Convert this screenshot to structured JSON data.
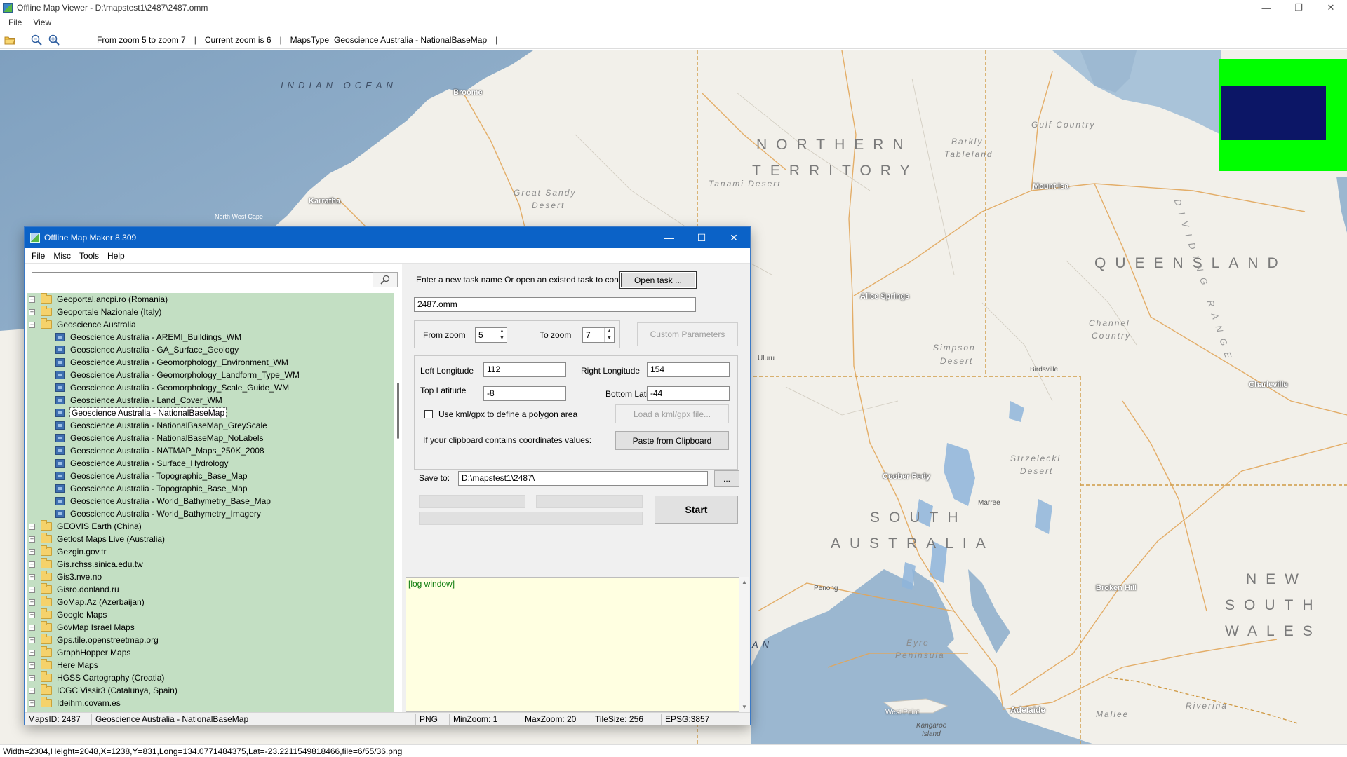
{
  "window": {
    "title": "Offline Map Viewer - D:\\mapstest1\\2487\\2487.omm",
    "controls": {
      "minimize": "—",
      "restore": "❐",
      "close": "✕"
    }
  },
  "menu": {
    "file": "File",
    "view": "View"
  },
  "toolbar": {
    "icons": [
      "folder-open-icon",
      "zoom-out-icon",
      "zoom-in-icon"
    ],
    "zoom_range": "From zoom 5 to zoom 7",
    "separator": "|",
    "current_zoom": "Current zoom is 6",
    "maps_type": "MapsType=Geoscience Australia - NationalBaseMap"
  },
  "map": {
    "region_labels": {
      "indian_ocean": "INDIAN OCEAN",
      "northern": "NORTHERN",
      "territory": "TERRITORY",
      "queensland": "QUEENSLAND",
      "south": "SOUTH",
      "australia": "AUSTRALIA",
      "new": "NEW",
      "south2": "SOUTH",
      "wales": "WALES",
      "dividing_range": "DIVIDING RANGE",
      "ocean_bottom": "AN"
    },
    "feature_labels": {
      "great_sandy": "Great Sandy",
      "desert": "Desert",
      "tanami": "Tanami Desert",
      "barkly": "Barkly",
      "tableland": "Tableland",
      "gulf_country": "Gulf Country",
      "channel": "Channel",
      "country": "Country",
      "simpson": "Simpson",
      "desert2": "Desert",
      "strzelecki": "Strzelecki",
      "desert3": "Desert",
      "eyre": "Eyre",
      "peninsula": "Peninsula",
      "mallee": "Mallee",
      "riverina": "Riverina",
      "kangaroo": "Kangaroo",
      "island": "Island",
      "north_west_cape": "North\nWest Cape"
    },
    "cities": {
      "broome": "Broome",
      "karratha": "Karratha",
      "mount_isa": "Mount Isa",
      "alice_springs": "Alice Springs",
      "charleville": "Charleville",
      "coober_pedy": "Coober Pedy",
      "broken_hill": "Broken Hill",
      "adelaide": "Adelaide"
    },
    "towns": {
      "birdsville": "Birdsville",
      "uluru": "Uluru",
      "marree": "Marree",
      "penong": "Penong",
      "west_point": "West Point"
    },
    "overview_colors": {
      "background": "#00ff00",
      "viewport": "#0c1666"
    }
  },
  "status_bar": "Width=2304,Height=2048,X=1238,Y=831,Long=134.0771484375,Lat=-23.2211549818466,file=6/55/36.png",
  "dialog": {
    "title": "Offline Map Maker 8.309",
    "controls": {
      "minimize": "—",
      "maximize": "☐",
      "close": "✕"
    },
    "menu": {
      "file": "File",
      "misc": "Misc",
      "tools": "Tools",
      "help": "Help"
    },
    "search": {
      "value": "",
      "button_icon": "magnifier-icon"
    },
    "tree": {
      "top_providers": [
        "Geoportal.ancpi.ro (Romania)",
        "Geoportale Nazionale (Italy)"
      ],
      "expanded_provider": "Geoscience Australia",
      "expanded_children": [
        "Geoscience Australia - AREMI_Buildings_WM",
        "Geoscience Australia - GA_Surface_Geology",
        "Geoscience Australia - Geomorphology_Environment_WM",
        "Geoscience Australia - Geomorphology_Landform_Type_WM",
        "Geoscience Australia - Geomorphology_Scale_Guide_WM",
        "Geoscience Australia - Land_Cover_WM",
        "Geoscience Australia - NationalBaseMap",
        "Geoscience Australia - NationalBaseMap_GreyScale",
        "Geoscience Australia - NationalBaseMap_NoLabels",
        "Geoscience Australia - NATMAP_Maps_250K_2008",
        "Geoscience Australia - Surface_Hydrology",
        "Geoscience Australia - Topographic_Base_Map",
        "Geoscience Australia - Topographic_Base_Map",
        "Geoscience Australia - World_Bathymetry_Base_Map",
        "Geoscience Australia - World_Bathymetry_Imagery"
      ],
      "selected_index": 6,
      "bottom_providers": [
        "GEOVIS Earth (China)",
        "Getlost Maps Live (Australia)",
        "Gezgin.gov.tr",
        "Gis.rchss.sinica.edu.tw",
        "Gis3.nve.no",
        "Gisro.donland.ru",
        "GoMap.Az (Azerbaijan)",
        "Google Maps",
        "GovMap Israel Maps",
        "Gps.tile.openstreetmap.org",
        "GraphHopper Maps",
        "Here Maps",
        "HGSS Cartography (Croatia)",
        "ICGC Vissir3 (Catalunya, Spain)",
        "Ideihm.covam.es"
      ],
      "expander_collapsed": "+",
      "expander_expanded": "−"
    },
    "task": {
      "prompt": "Enter a new task name Or open an existed task to continue:",
      "open_button": "Open task ...",
      "name_value": "2487.omm"
    },
    "zoom": {
      "from_label": "From zoom",
      "from_value": "5",
      "to_label": "To zoom",
      "to_value": "7",
      "custom_button": "Custom Parameters",
      "spin_up": "▲",
      "spin_down": "▼"
    },
    "bounds": {
      "left_label": "Left Longitude",
      "left_value": "112",
      "right_label": "Right Longitude",
      "right_value": "154",
      "top_label": "Top Latitude",
      "top_value": "-8",
      "bottom_label": "Bottom Latitude",
      "bottom_value": "-44",
      "kml_checkbox_label": "Use kml/gpx to define a polygon area",
      "kml_button": "Load a kml/gpx file...",
      "clipboard_label": "If your clipboard contains coordinates values:",
      "clipboard_button": "Paste from Clipboard"
    },
    "save": {
      "label": "Save to:",
      "value": "D:\\mapstest1\\2487\\",
      "browse_button": "..."
    },
    "start_button": "Start",
    "log": {
      "text": "[log window]",
      "scroll_up": "▲",
      "scroll_down": "▼"
    },
    "status": {
      "maps_id": "MapsID: 2487",
      "maps_name": "Geoscience Australia - NationalBaseMap",
      "format": "PNG",
      "min_zoom": "MinZoom: 1",
      "max_zoom": "MaxZoom: 20",
      "tile_size": "TileSize: 256",
      "epsg": "EPSG:3857"
    }
  }
}
